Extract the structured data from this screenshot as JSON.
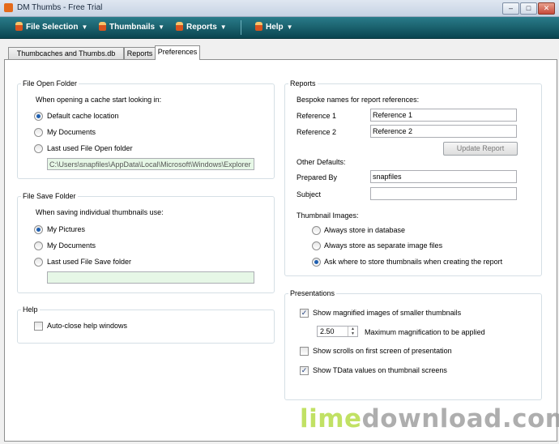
{
  "window": {
    "title": "DM Thumbs - Free Trial",
    "min_glyph": "–",
    "max_glyph": "□",
    "close_glyph": "✕"
  },
  "toolbar": {
    "menus": [
      {
        "label": "File Selection",
        "arrow": "▼"
      },
      {
        "label": "Thumbnails",
        "arrow": "▼"
      },
      {
        "label": "Reports",
        "arrow": "▼"
      },
      {
        "label": "Help",
        "arrow": "▼"
      }
    ]
  },
  "tabs": [
    "Thumbcaches and Thumbs.db Files",
    "Reports",
    "Preferences"
  ],
  "file_open": {
    "title": "File Open Folder",
    "prompt": "When opening a cache start looking in:",
    "options": [
      "Default cache location",
      "My Documents",
      "Last used File Open folder"
    ],
    "selected": 0,
    "path": "C:\\Users\\snapfiles\\AppData\\Local\\Microsoft\\Windows\\Explorer"
  },
  "file_save": {
    "title": "File Save Folder",
    "prompt": "When saving individual thumbnails use:",
    "options": [
      "My Pictures",
      "My Documents",
      "Last used File Save folder"
    ],
    "selected": 0,
    "path": ""
  },
  "help": {
    "title": "Help",
    "autoclose_label": "Auto-close help windows",
    "autoclose_checked": false
  },
  "reports": {
    "title": "Reports",
    "bespoke_label": "Bespoke names for report references:",
    "ref1_label": "Reference 1",
    "ref1_value": "Reference 1",
    "ref2_label": "Reference 2",
    "ref2_value": "Reference 2",
    "update_button": "Update Report",
    "other_defaults_label": "Other Defaults:",
    "prepared_by_label": "Prepared By",
    "prepared_by_value": "snapfiles",
    "subject_label": "Subject",
    "subject_value": "",
    "thumb_images_label": "Thumbnail Images:",
    "thumb_options": [
      "Always store in database",
      "Always store as separate image files",
      "Ask where to store thumbnails when creating the report"
    ],
    "thumb_selected": 2
  },
  "presentations": {
    "title": "Presentations",
    "show_magnified_label": "Show magnified images of smaller thumbnails",
    "show_magnified_checked": true,
    "max_mag_value": "2.50",
    "max_mag_label": "Maximum magnification to be applied",
    "show_scrolls_label": "Show scrolls on first screen of presentation",
    "show_scrolls_checked": false,
    "show_tdata_label": "Show TData values on thumbnail screens",
    "show_tdata_checked": true
  },
  "watermark": {
    "part1": "lime",
    "part2": "download.com"
  },
  "check_glyph": "✓",
  "spin_up": "▲",
  "spin_down": "▼"
}
